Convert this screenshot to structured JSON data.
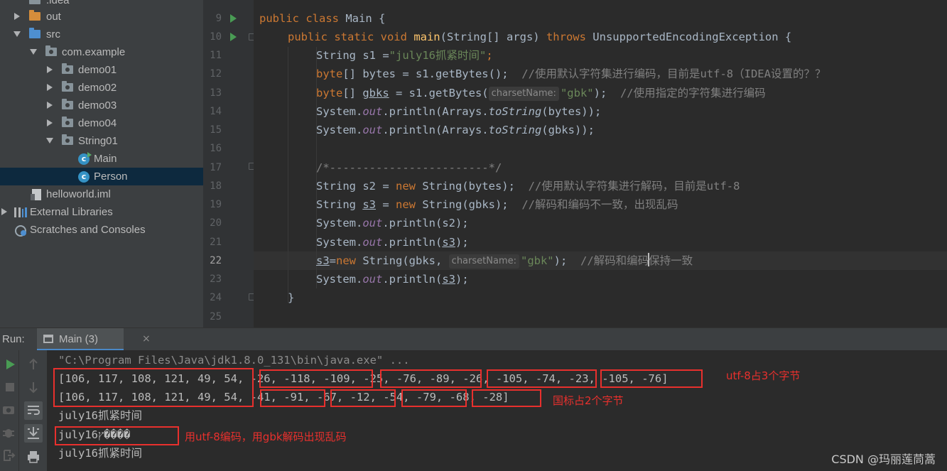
{
  "project_tree": {
    "items": [
      {
        "label": ".idea"
      },
      {
        "label": "out"
      },
      {
        "label": "src"
      },
      {
        "label": "com.example"
      },
      {
        "label": "demo01"
      },
      {
        "label": "demo02"
      },
      {
        "label": "demo03"
      },
      {
        "label": "demo04"
      },
      {
        "label": "String01"
      },
      {
        "label": "Main"
      },
      {
        "label": "Person"
      },
      {
        "label": "helloworld.iml"
      },
      {
        "label": "External Libraries"
      },
      {
        "label": "Scratches and Consoles"
      }
    ],
    "selected": "Person"
  },
  "editor": {
    "line_numbers": [
      "9",
      "10",
      "11",
      "12",
      "13",
      "14",
      "15",
      "16",
      "17",
      "18",
      "19",
      "20",
      "21",
      "22",
      "23",
      "24",
      "25"
    ],
    "current_line": "22",
    "code": {
      "l9_kw": "public class ",
      "l9_name": "Main {",
      "l10_kw": "public static void ",
      "l10_mth": "main",
      "l10_a": "(String[] args) ",
      "l10_kw2": "throws ",
      "l10_b": "UnsupportedEncodingException {",
      "l11_a": "String s1 =",
      "l11_str": "\"july16抓紧时间\"",
      "l11_b": ";",
      "l12_kw": "byte",
      "l12_a": "[] bytes = s1.getBytes();  ",
      "l12_cmt": "//使用默认字符集进行编码，目前是utf-8（IDEA设置的？？",
      "l13_kw": "byte",
      "l13_a": "[] ",
      "l13_var": "gbks",
      "l13_b": " = s1.getBytes(",
      "l13_hint": "charsetName:",
      "l13_str": "\"gbk\"",
      "l13_c": ");  ",
      "l13_cmt": "//使用指定的字符集进行编码",
      "l14_a": "System.",
      "l14_fld": "out",
      "l14_b": ".println(Arrays.",
      "l14_smt": "toString",
      "l14_c": "(bytes));",
      "l15_a": "System.",
      "l15_fld": "out",
      "l15_b": ".println(Arrays.",
      "l15_smt": "toString",
      "l15_c": "(gbks));",
      "l17_cmt": "/*------------------------*/",
      "l18_a": "String s2 = ",
      "l18_kw": "new ",
      "l18_b": "String(bytes);  ",
      "l18_cmt": "//使用默认字符集进行解码，目前是utf-8",
      "l19_a": "String ",
      "l19_var": "s3",
      "l19_b": " = ",
      "l19_kw": "new ",
      "l19_c": "String(gbks);  ",
      "l19_cmt": "//解码和编码不一致，出现乱码",
      "l20_a": "System.",
      "l20_fld": "out",
      "l20_b": ".println(s2);",
      "l21_a": "System.",
      "l21_fld": "out",
      "l21_b": ".println(",
      "l21_var": "s3",
      "l21_c": ");",
      "l22_var": "s3",
      "l22_a": "=",
      "l22_kw": "new ",
      "l22_b": "String(gbks, ",
      "l22_hint": "charsetName:",
      "l22_str": "\"gbk\"",
      "l22_c": ");  ",
      "l22_cmt1": "//解码和编码",
      "l22_cmt2": "保持一致",
      "l23_a": "System.",
      "l23_fld": "out",
      "l23_b": ".println(",
      "l23_var": "s3",
      "l23_c": ");",
      "l24": "}"
    }
  },
  "run_panel": {
    "label": "Run:",
    "tab_label": "Main (3)",
    "tab_close": "×",
    "console_lines": [
      "\"C:\\Program Files\\Java\\jdk1.8.0_131\\bin\\java.exe\" ...",
      "[106, 117, 108, 121, 49, 54, -26, -118, -109, -25, -76, -89, -26, -105, -74, -23, -105, -76]",
      "[106, 117, 108, 121, 49, 54, -41, -91, -67, -12, -54, -79, -68, -28]",
      "july16抓紧时间",
      "july16ץ����",
      "july16抓紧时间"
    ]
  },
  "annotations": {
    "utf8_note": "utf-8占3个字节",
    "gbk_note": "国标占2个字节",
    "garbled_note": "用utf-8编码，用gbk解码出现乱码",
    "highlight_color": "#e8302d"
  },
  "watermark": "CSDN @玛丽莲茼蒿"
}
